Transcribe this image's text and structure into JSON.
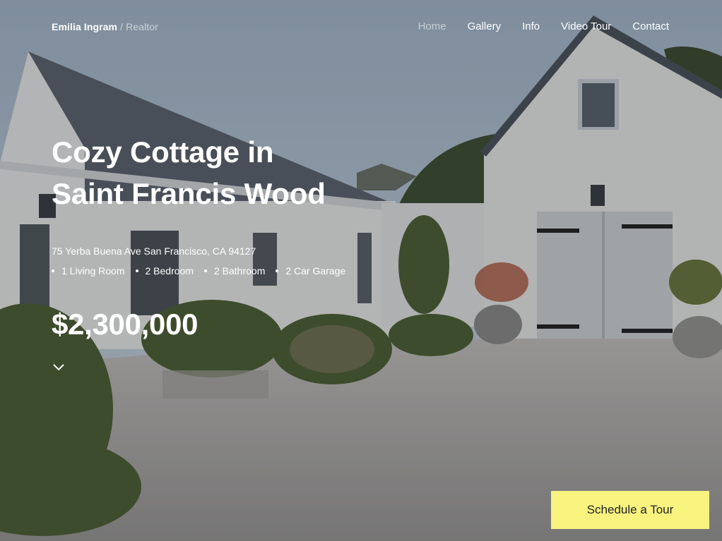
{
  "brand": {
    "name": "Emilia Ingram",
    "separator": "/",
    "role": "Realtor"
  },
  "nav": {
    "items": [
      "Home",
      "Gallery",
      "Info",
      "Video Tour",
      "Contact"
    ],
    "active": "Home"
  },
  "listing": {
    "title_line1": "Cozy Cottage in",
    "title_line2": "Saint Francis Wood",
    "address": "75 Yerba Buena Ave San Francisco, CA 94127",
    "features": [
      "1 Living Room",
      "2 Bedroom",
      "2 Bathroom",
      "2 Car Garage"
    ],
    "price": "$2,300,000"
  },
  "scroll_icon": "chevron-down-icon",
  "cta": {
    "label": "Schedule a Tour"
  },
  "colors": {
    "cta_bg": "#f8f27f",
    "text": "#ffffff",
    "nav_active": "#c8ccd0"
  }
}
